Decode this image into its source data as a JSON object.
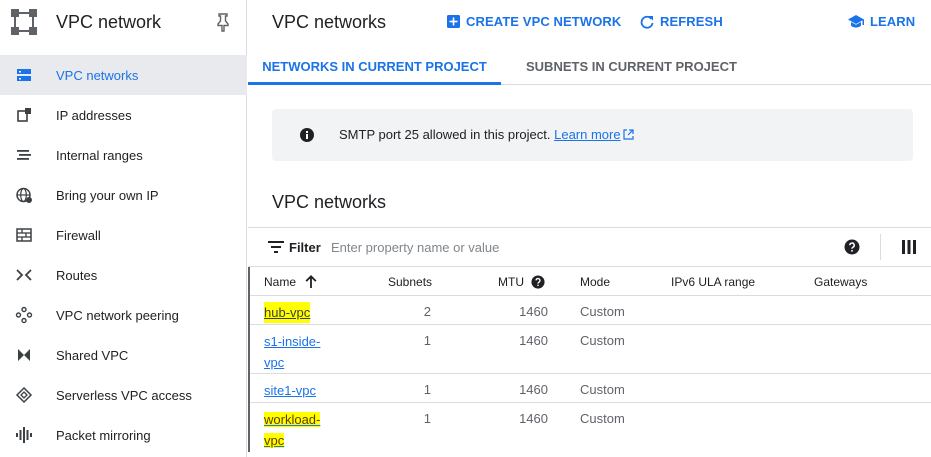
{
  "sidebar": {
    "title": "VPC network",
    "items": [
      {
        "label": "VPC networks",
        "icon": "vpc-networks-icon",
        "active": true
      },
      {
        "label": "IP addresses",
        "icon": "ip-addresses-icon",
        "active": false
      },
      {
        "label": "Internal ranges",
        "icon": "internal-ranges-icon",
        "active": false
      },
      {
        "label": "Bring your own IP",
        "icon": "globe-icon",
        "active": false
      },
      {
        "label": "Firewall",
        "icon": "firewall-icon",
        "active": false
      },
      {
        "label": "Routes",
        "icon": "routes-icon",
        "active": false
      },
      {
        "label": "VPC network peering",
        "icon": "peering-icon",
        "active": false
      },
      {
        "label": "Shared VPC",
        "icon": "shared-vpc-icon",
        "active": false
      },
      {
        "label": "Serverless VPC access",
        "icon": "serverless-icon",
        "active": false
      },
      {
        "label": "Packet mirroring",
        "icon": "packet-mirroring-icon",
        "active": false
      }
    ]
  },
  "header": {
    "title": "VPC networks",
    "create_label": "CREATE VPC NETWORK",
    "refresh_label": "REFRESH",
    "learn_label": "LEARN"
  },
  "tabs": [
    {
      "label": "NETWORKS IN CURRENT PROJECT",
      "active": true
    },
    {
      "label": "SUBNETS IN CURRENT PROJECT",
      "active": false
    }
  ],
  "info": {
    "text": "SMTP port 25 allowed in this project.",
    "link": "Learn more"
  },
  "section_title": "VPC networks",
  "filter": {
    "label": "Filter",
    "placeholder": "Enter property name or value"
  },
  "table": {
    "columns": [
      "Name",
      "Subnets",
      "MTU",
      "Mode",
      "IPv6 ULA range",
      "Gateways"
    ],
    "rows": [
      {
        "name_lines": [
          "hub-vpc"
        ],
        "subnets": "2",
        "mtu": "1460",
        "mode": "Custom",
        "highlight": true
      },
      {
        "name_lines": [
          "s1-inside-",
          "vpc"
        ],
        "subnets": "1",
        "mtu": "1460",
        "mode": "Custom",
        "highlight": false
      },
      {
        "name_lines": [
          "site1-vpc"
        ],
        "subnets": "1",
        "mtu": "1460",
        "mode": "Custom",
        "highlight": false
      },
      {
        "name_lines": [
          "workload-",
          "vpc"
        ],
        "subnets": "1",
        "mtu": "1460",
        "mode": "Custom",
        "highlight": true
      }
    ]
  },
  "colors": {
    "accent": "#1a73e8",
    "highlight": "#ffff00",
    "active_bg": "#e8eaed"
  }
}
